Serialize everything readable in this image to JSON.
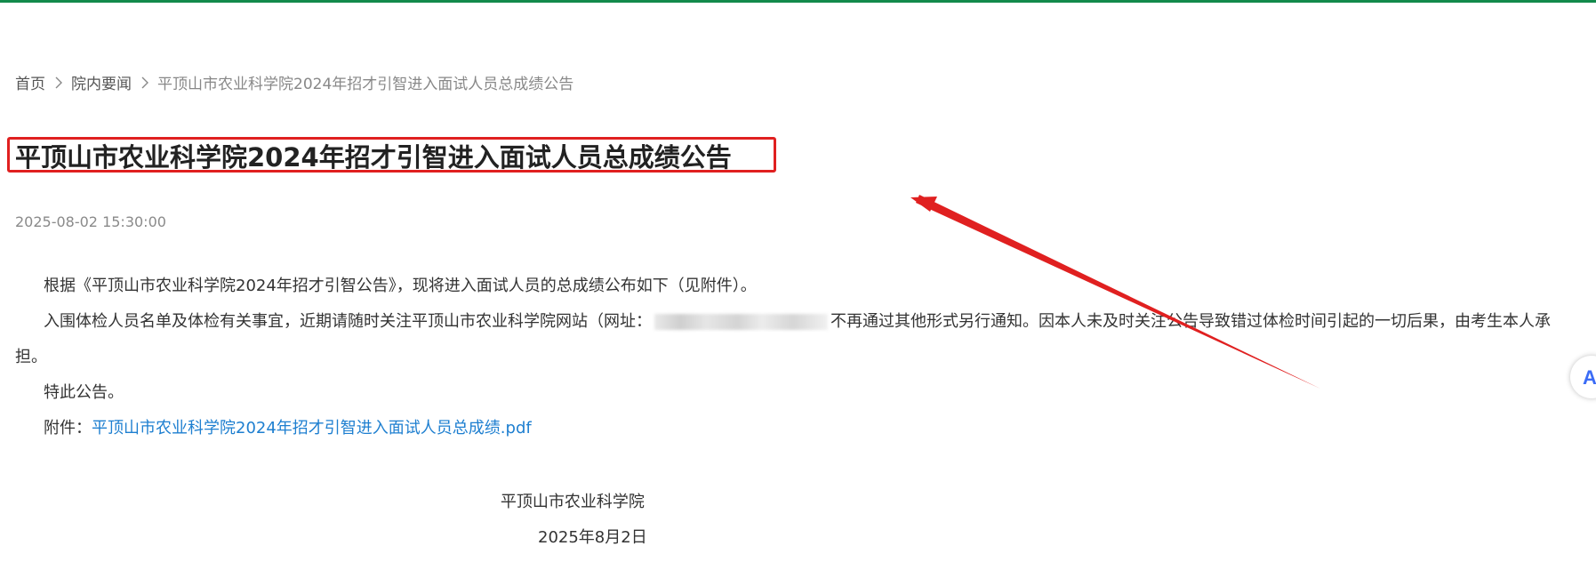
{
  "breadcrumb": {
    "home": "首页",
    "section": "院内要闻",
    "current": "平顶山市农业科学院2024年招才引智进入面试人员总成绩公告"
  },
  "article": {
    "title": "平顶山市农业科学院2024年招才引智进入面试人员总成绩公告",
    "date": "2025-08-02 15:30:00",
    "para1": "根据《平顶山市农业科学院2024年招才引智公告》，现将进入面试人员的总成绩公布如下（见附件）。",
    "para2_before": "入围体检人员名单及体检有关事宜，近期请随时关注平顶山市农业科学院网站（网址：",
    "para2_after": "不再通过其他形式另行通知。因本人未及时关注公告导致错过体检时间引起的一切后果，由考生本人承担。",
    "para3": "特此公告。",
    "attachment_label": "附件：",
    "attachment_link": "平顶山市农业科学院2024年招才引智进入面试人员总成绩.pdf",
    "signature_org": "平顶山市农业科学院",
    "signature_date": "2025年8月2日"
  },
  "annotation": {
    "highlight_color": "#e02020"
  },
  "side_widget": {
    "glyph": "A"
  },
  "colors": {
    "top_line": "#128a4b",
    "link": "#1e7fd0"
  }
}
